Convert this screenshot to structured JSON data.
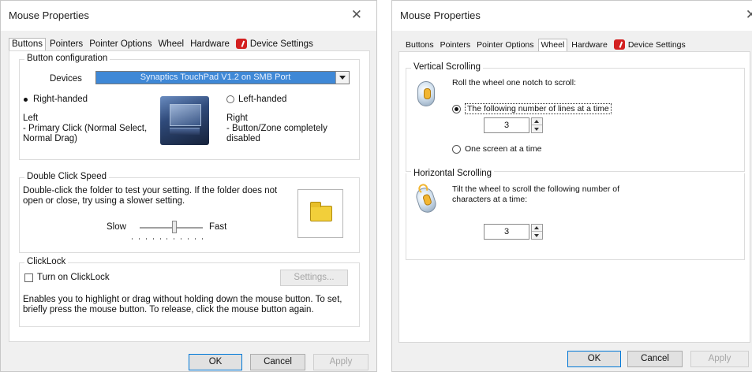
{
  "left": {
    "title": "Mouse Properties",
    "close_glyph": "✕",
    "tabs": [
      {
        "label": "Buttons",
        "active": true
      },
      {
        "label": "Pointers"
      },
      {
        "label": "Pointer Options"
      },
      {
        "label": "Wheel"
      },
      {
        "label": "Hardware"
      },
      {
        "label": "Device Settings",
        "icon": "device-settings-icon"
      }
    ],
    "button_config": {
      "group_label": "Button configuration",
      "devices_label": "Devices",
      "device_value": "Synaptics TouchPad V1.2 on SMB Port",
      "right_handed": "Right-handed",
      "left_handed": "Left-handed",
      "selected": "Right-handed",
      "left_desc_1": "Left",
      "left_desc_2": " - Primary Click (Normal Select,",
      "left_desc_3": "Normal Drag)",
      "right_desc_1": "Right",
      "right_desc_2": " - Button/Zone completely",
      "right_desc_3": "disabled"
    },
    "double_click": {
      "group_label": "Double Click Speed",
      "line1": "Double-click the folder to test your setting.  If the folder does not",
      "line2": "open or close, try using a slower setting.",
      "slow": "Slow",
      "fast": "Fast",
      "speed_fraction": 0.55,
      "tick_count": 11
    },
    "clicklock": {
      "group_label": "ClickLock",
      "checkbox_label": "Turn on ClickLock",
      "checked": false,
      "settings_button": "Settings...",
      "line1": "Enables you to highlight or drag without holding down the mouse button.  To set,",
      "line2": "briefly press the mouse button.  To release, click the mouse button again."
    },
    "buttons": {
      "ok": "OK",
      "cancel": "Cancel",
      "apply": "Apply"
    }
  },
  "right": {
    "title": "Mouse Properties",
    "close_glyph": "✕",
    "tabs": [
      {
        "label": "Buttons"
      },
      {
        "label": "Pointers"
      },
      {
        "label": "Pointer Options"
      },
      {
        "label": "Wheel",
        "active": true
      },
      {
        "label": "Hardware"
      },
      {
        "label": "Device Settings",
        "icon": "device-settings-icon"
      }
    ],
    "vertical": {
      "group_label": "Vertical Scrolling",
      "intro": "Roll the wheel one notch to scroll:",
      "option_lines": "The following number of lines at a time",
      "option_screen": "One screen at a time",
      "selected": "lines",
      "lines_value": "3"
    },
    "horizontal": {
      "group_label": "Horizontal Scrolling",
      "line1": "Tilt the wheel to scroll the following number of",
      "line2": "characters at a time:",
      "chars_value": "3"
    },
    "buttons": {
      "ok": "OK",
      "cancel": "Cancel",
      "apply": "Apply"
    }
  }
}
